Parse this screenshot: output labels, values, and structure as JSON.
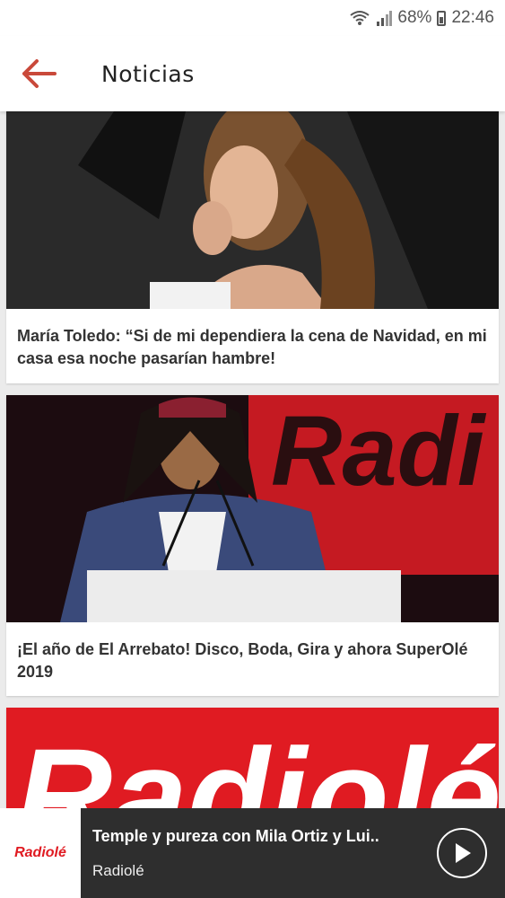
{
  "status_bar": {
    "battery": "68%",
    "time": "22:46"
  },
  "appbar": {
    "title": "Noticias",
    "back_icon": "arrow-left-icon",
    "accent": "#c9493a"
  },
  "news": [
    {
      "title": "María Toledo: “Si de mi dependiera la cena de Navidad, en mi casa esa noche pasarían hambre!"
    },
    {
      "title": "¡El año de El Arrebato! Disco, Boda, Gira y ahora SuperOlé 2019",
      "image_text": "Radi"
    },
    {
      "title": "",
      "image_text": "Radiolé"
    }
  ],
  "player": {
    "logo": "Radiolé",
    "track": "Temple y pureza con Mila Ortiz y Lui..",
    "station": "Radiolé",
    "play_icon": "play-icon"
  },
  "colors": {
    "brand_red": "#e01b22",
    "player_bg": "#2e2e2e"
  }
}
